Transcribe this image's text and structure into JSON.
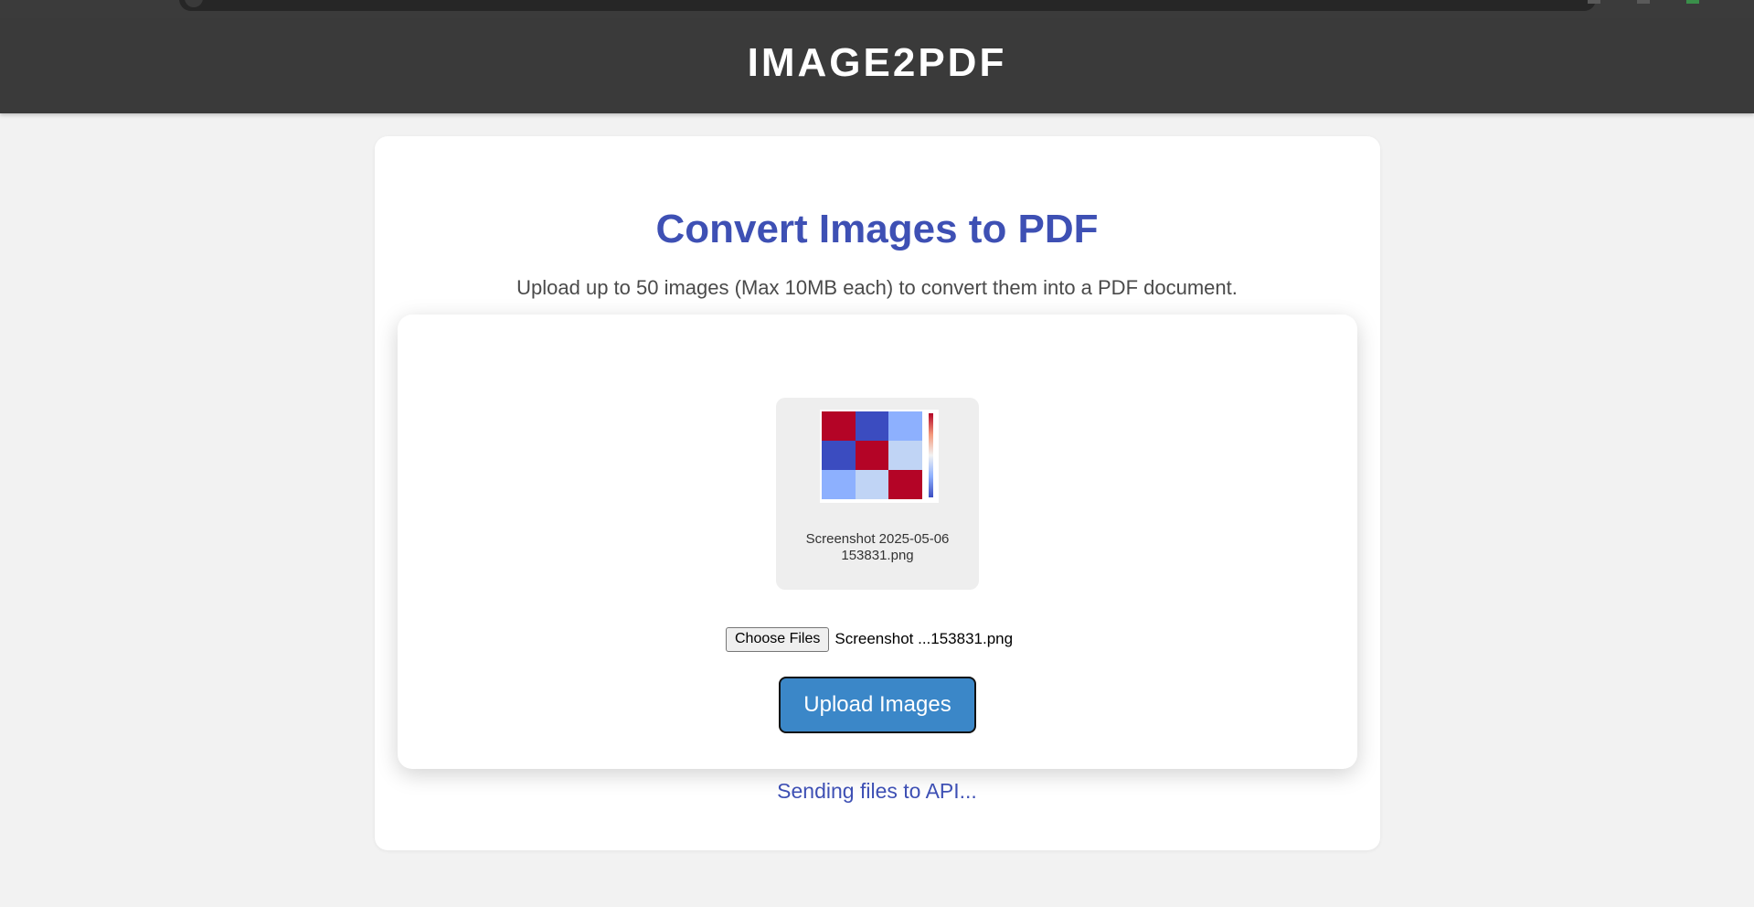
{
  "app": {
    "title": "IMAGE2PDF"
  },
  "main": {
    "heading": "Convert Images to PDF",
    "subtitle": "Upload up to 50 images (Max 10MB each) to convert them into a PDF document."
  },
  "preview": {
    "file_name_line1": "Screenshot 2025-05-06",
    "file_name_line2": "153831.png",
    "thumbnail_icon": "heatmap-thumbnail",
    "colors": {
      "red": "#b40426",
      "blue": "#3b4cc0",
      "mid": "#8db0fe",
      "light": "#c0d4f5"
    }
  },
  "file_input": {
    "button_label": "Choose Files",
    "selected_file": "Screenshot ...153831.png"
  },
  "upload": {
    "button_label": "Upload Images",
    "button_color": "#3b87c8"
  },
  "status": {
    "message": "Sending files to API..."
  },
  "theme": {
    "header_bg": "#3a3a3a",
    "accent": "#3e50b4"
  }
}
